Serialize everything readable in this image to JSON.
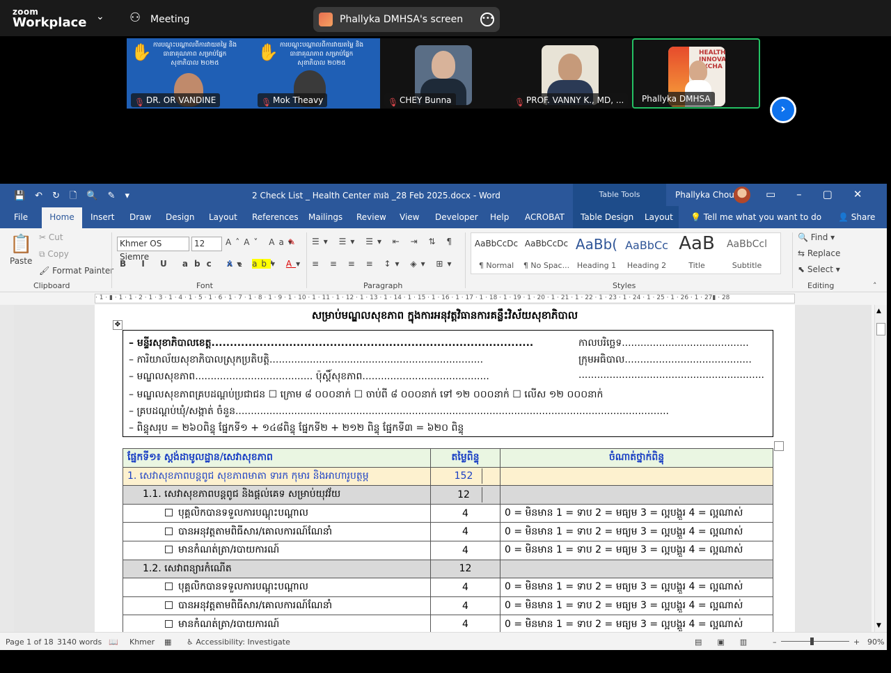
{
  "zoom": {
    "brand_small": "zoom",
    "brand_big": "Workplace",
    "meeting_label": "Meeting",
    "share_label": "Phallyka DMHSA's screen"
  },
  "participants": [
    {
      "name": "DR. OR VANDINE",
      "banner": "ការបណ្តុះបណ្តាលពីការវាយតម្លៃ និងធានាគុណភាព សម្រាប់ផ្នែកសុខាភិបាល ២០២៥"
    },
    {
      "name": "Mok Theavy",
      "banner": "ការបណ្តុះបណ្តាលពីការវាយតម្លៃ និងធានាគុណភាព សម្រាប់ផ្នែកសុខាភិបាល ២០២៥"
    },
    {
      "name": "CHEY Bunna"
    },
    {
      "name": "PROF. VANNY K., MD, ..."
    },
    {
      "name": "Phallyka DMHSA",
      "bg_text": "HEALTH INNOVA EXCHA"
    }
  ],
  "word": {
    "title": "2 Check List _ Health Center តារង _28 Feb 2025.docx  -  Word",
    "table_tools": "Table Tools",
    "user": "Phallyka Chou",
    "tabs": [
      "File",
      "Home",
      "Insert",
      "Draw",
      "Design",
      "Layout",
      "References",
      "Mailings",
      "Review",
      "View",
      "Developer",
      "Help",
      "ACROBAT",
      "Table Design",
      "Layout"
    ],
    "tell_me": "Tell me what you want to do",
    "share": "Share",
    "clipboard": {
      "paste": "Paste",
      "cut": "Cut",
      "copy": "Copy",
      "format_painter": "Format Painter",
      "label": "Clipboard"
    },
    "font": {
      "name": "Khmer OS Siemre",
      "size": "12",
      "label": "Font"
    },
    "paragraph_label": "Paragraph",
    "styles": [
      {
        "sample": "AaBbCcDc",
        "name": "¶ Normal"
      },
      {
        "sample": "AaBbCcDc",
        "name": "¶ No Spac..."
      },
      {
        "sample": "AaBb(",
        "name": "Heading 1"
      },
      {
        "sample": "AaBbCc",
        "name": "Heading 2"
      },
      {
        "sample": "AaB",
        "name": "Title"
      },
      {
        "sample": "AaBbCcl",
        "name": "Subtitle"
      }
    ],
    "styles_label": "Styles",
    "editing": {
      "find": "Find",
      "replace": "Replace",
      "select": "Select",
      "label": "Editing"
    },
    "ruler": "· 1 · ▮ · 1 · 1 · 2 · 1 · 3 · 1 · 4 · 1 · 5 · 1 · 6 · 1 · 7 · 1 · 8 · 1 · 9 · 1 · 10 · 1 · 11 · 1 · 12 · 1 · 13 · 1 · 14 · 1 · 15 · 1 · 16 · 1 · 17 · 1 · 18 · 1 · 19 · 1 · 20 · 1 · 21 · 1 · 22 · 1 · 23 · 1 · 24 · 1 · 25 · 1 · 26 · 1 · 27▮ · 28"
  },
  "document": {
    "heading": "សម្រាប់មណ្ឌលសុខភាព ក្នុងការអនុវត្តវិធានការគន្លឹះវិស័យសុខាភិបាល",
    "info_lines": [
      "–   មន្ទីរសុខាភិបាលខេត្ត.......................................................................................",
      "–   ការិយាល័យសុខាភិបាលស្រុកប្រតិបត្តិ.....................................................................",
      "–   មណ្ឌលសុខភាព...................................... ប៉ុស្តិ៍សុខភាព.........................................",
      "–   មណ្ឌលសុខភាពគ្របដណ្តប់ប្រជាជន ☐ ក្រោម ៨ ០០០នាក់    ☐ ចាប់ពី ៨ ០០០នាក់ ទៅ ១២ ០០០នាក់    ☐ លើស ១២ ០០០នាក់",
      "–   គ្របដណ្តប់ឃុំ/សង្កាត់ ចំនួន............................................................................................................................................",
      "–   ពិន្ទុសរុប = ២៦០ពិន្ទុ ផ្នែកទី១  + ១៤៨ពិន្ទុ ផ្នែកទី២ + ២១២ ពិន្ទុ ផ្នែកទី៣ = ៦២០ ពិន្ទុ"
    ],
    "info_right": [
      "កាលបរិច្ឆេទ.........................................",
      "ក្រុមអធិបាល.........................................",
      "............................................................"
    ],
    "table_header": [
      "ផ្នែកទី១៖ ស្តង់ដាមូលដ្ឋាន/សេវាសុខភាព",
      "តម្លៃពិន្ទុ",
      "ចំណាត់ថ្នាក់ពិន្ទុ"
    ],
    "rows": [
      {
        "type": "section",
        "label": "1.  សេវាសុខភាពបន្តពូជ សុខភាពមាតា ទារក កុមារ និងអាហារូបត្ថម្ភ",
        "score": "152",
        "scale": ""
      },
      {
        "type": "sub",
        "label": "1.1.  សេវាសុខភាពបន្តពូជ និងផ្តល់គេទ សម្រាប់យុវវ័យ",
        "score": "12",
        "scale": ""
      },
      {
        "type": "item",
        "label": "បុគ្គលិកបានទទួលការបណ្តុះបណ្តាល",
        "score": "4",
        "scale": "0 = មិនមាន    1 = ទាប    2 = មធ្យម    3 = ល្អបង្គួរ    4 = ល្អណាស់"
      },
      {
        "type": "item",
        "label": "បានអនុវត្តតាមពិធីសារ/គោលការណ៍ណែនាំ",
        "score": "4",
        "scale": "0 = មិនមាន    1 = ទាប    2 = មធ្យម    3 = ល្អបង្គួរ    4 = ល្អណាស់"
      },
      {
        "type": "item",
        "label": "មានកំណត់ត្រា/របាយការណ៍",
        "score": "4",
        "scale": "0 = មិនមាន    1 = ទាប    2 = មធ្យម    3 = ល្អបង្គួរ    4 = ល្អណាស់"
      },
      {
        "type": "sub",
        "label": "1.2.  សេវាពន្យារកំណើត",
        "score": "12",
        "scale": ""
      },
      {
        "type": "item",
        "label": "បុគ្គលិកបានទទួលការបណ្តុះបណ្តាល",
        "score": "4",
        "scale": "0 = មិនមាន    1 = ទាប    2 = មធ្យម    3 = ល្អបង្គួរ    4 = ល្អណាស់"
      },
      {
        "type": "item",
        "label": "បានអនុវត្តតាមពិធីសារ/គោលការណ៍ណែនាំ",
        "score": "4",
        "scale": "0 = មិនមាន    1 = ទាប    2 = មធ្យម    3 = ល្អបង្គួរ    4 = ល្អណាស់"
      },
      {
        "type": "item",
        "label": "មានកំណត់ត្រា/របាយការណ៍",
        "score": "4",
        "scale": "0 = មិនមាន    1 = ទាប    2 = មធ្យម    3 = ល្អបង្គួរ    4 = ល្អណាស់"
      }
    ]
  },
  "status": {
    "page": "Page 1 of 18",
    "words": "3140 words",
    "language": "Khmer",
    "accessibility": "Accessibility: Investigate",
    "zoom": "90%"
  }
}
